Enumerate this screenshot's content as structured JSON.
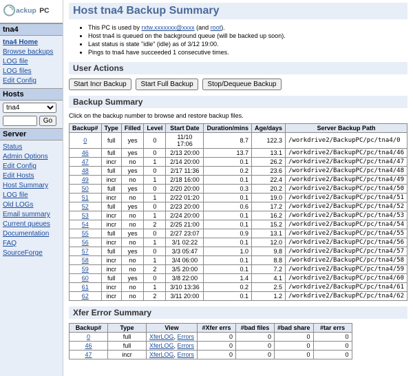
{
  "logo_text": "BackupPC",
  "host_label": "tna4",
  "nav1": [
    {
      "t": "tna4 Home",
      "b": true
    },
    {
      "t": "Browse backups"
    },
    {
      "t": "LOG file"
    },
    {
      "t": "LOG files"
    },
    {
      "t": "Edit Config"
    }
  ],
  "hosts_hdr": "Hosts",
  "host_select": "tna4",
  "host_input": "",
  "go_btn": "Go",
  "server_hdr": "Server",
  "nav2": [
    {
      "t": "Status"
    },
    {
      "t": "Admin Options"
    },
    {
      "t": "Edit Config"
    },
    {
      "t": "Edit Hosts"
    },
    {
      "t": "Host Summary"
    },
    {
      "t": "LOG file"
    },
    {
      "t": "Old LOGs"
    },
    {
      "t": "Email summary"
    },
    {
      "t": "Current queues"
    },
    {
      "t": "Documentation"
    },
    {
      "t": "FAQ"
    },
    {
      "t": "SourceForge"
    }
  ],
  "title": "Host tna4 Backup Summary",
  "bullets": [
    "This PC is used by <a href='#'>rxtw.xxxxxxx@xxxx</a> (and <a href='#'>root</a>).",
    "Host tna4 is queued on the background queue (will be backed up soon).",
    "Last status is state \"idle\" (idle) as of 3/12 19:00.",
    "Pings to tna4 have succeeded 1 consecutive times."
  ],
  "ua_hdr": "User Actions",
  "btn1": "Start Incr Backup",
  "btn2": "Start Full Backup",
  "btn3": "Stop/Dequeue Backup",
  "bs_hdr": "Backup Summary",
  "bs_note": "Click on the backup number to browse and restore backup files.",
  "bs_cols": [
    "Backup#",
    "Type",
    "Filled",
    "Level",
    "Start Date",
    "Duration/mins",
    "Age/days",
    "Server Backup Path"
  ],
  "bs_rows": [
    [
      "0",
      "full",
      "yes",
      "0",
      "11/10 17:06",
      "8.7",
      "122.3",
      "/workdrive2/BackupPC/pc/tna4/0"
    ],
    [
      "46",
      "full",
      "yes",
      "0",
      "2/13 20:00",
      "13.7",
      "13.1",
      "/workdrive2/BackupPC/pc/tna4/46"
    ],
    [
      "47",
      "incr",
      "no",
      "1",
      "2/14 20:00",
      "0.1",
      "26.2",
      "/workdrive2/BackupPC/pc/tna4/47"
    ],
    [
      "48",
      "full",
      "yes",
      "0",
      "2/17 11:36",
      "0.2",
      "23.6",
      "/workdrive2/BackupPC/pc/tna4/48"
    ],
    [
      "49",
      "incr",
      "no",
      "1",
      "2/18 16:00",
      "0.1",
      "22.4",
      "/workdrive2/BackupPC/pc/tna4/49"
    ],
    [
      "50",
      "full",
      "yes",
      "0",
      "2/20 20:00",
      "0.3",
      "20.2",
      "/workdrive2/BackupPC/pc/tna4/50"
    ],
    [
      "51",
      "incr",
      "no",
      "1",
      "2/22 01:20",
      "0.1",
      "19.0",
      "/workdrive2/BackupPC/pc/tna4/51"
    ],
    [
      "52",
      "full",
      "yes",
      "0",
      "2/23 20:00",
      "0.6",
      "17.2",
      "/workdrive2/BackupPC/pc/tna4/52"
    ],
    [
      "53",
      "incr",
      "no",
      "1",
      "2/24 20:00",
      "0.1",
      "16.2",
      "/workdrive2/BackupPC/pc/tna4/53"
    ],
    [
      "54",
      "incr",
      "no",
      "2",
      "2/25 21:00",
      "0.1",
      "15.2",
      "/workdrive2/BackupPC/pc/tna4/54"
    ],
    [
      "55",
      "full",
      "yes",
      "0",
      "2/27 23:07",
      "0.9",
      "13.1",
      "/workdrive2/BackupPC/pc/tna4/55"
    ],
    [
      "56",
      "incr",
      "no",
      "1",
      "3/1 02:22",
      "0.1",
      "12.0",
      "/workdrive2/BackupPC/pc/tna4/56"
    ],
    [
      "57",
      "full",
      "yes",
      "0",
      "3/3 05:47",
      "1.0",
      "9.8",
      "/workdrive2/BackupPC/pc/tna4/57"
    ],
    [
      "58",
      "incr",
      "no",
      "1",
      "3/4 06:00",
      "0.1",
      "8.8",
      "/workdrive2/BackupPC/pc/tna4/58"
    ],
    [
      "59",
      "incr",
      "no",
      "2",
      "3/5 20:00",
      "0.1",
      "7.2",
      "/workdrive2/BackupPC/pc/tna4/59"
    ],
    [
      "60",
      "full",
      "yes",
      "0",
      "3/8 22:00",
      "1.4",
      "4.1",
      "/workdrive2/BackupPC/pc/tna4/60"
    ],
    [
      "61",
      "incr",
      "no",
      "1",
      "3/10 13:36",
      "0.2",
      "2.5",
      "/workdrive2/BackupPC/pc/tna4/61"
    ],
    [
      "62",
      "incr",
      "no",
      "2",
      "3/11 20:00",
      "0.1",
      "1.2",
      "/workdrive2/BackupPC/pc/tna4/62"
    ]
  ],
  "xe_hdr": "Xfer Error Summary",
  "xe_cols": [
    "Backup#",
    "Type",
    "View",
    "#Xfer errs",
    "#bad files",
    "#bad share",
    "#tar errs"
  ],
  "xe_view": "XferLOG, Errors",
  "xe_rows": [
    [
      "0",
      "full",
      "0",
      "0",
      "0",
      "0"
    ],
    [
      "46",
      "full",
      "0",
      "0",
      "0",
      "0"
    ],
    [
      "47",
      "incr",
      "0",
      "0",
      "0",
      "0"
    ]
  ]
}
